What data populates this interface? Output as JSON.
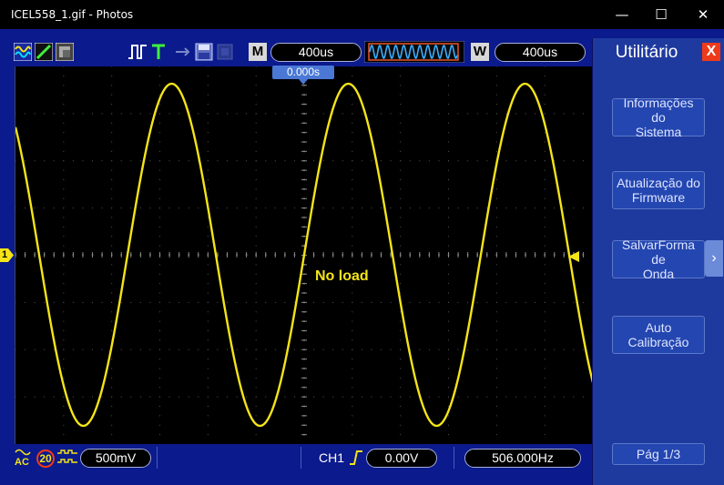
{
  "window": {
    "title": "ICEL558_1.gif - Photos",
    "minimize_glyph": "—",
    "maximize_glyph": "☐",
    "close_glyph": "✕"
  },
  "toolbar": {
    "mode_badge": "M",
    "timebase": "400us",
    "window_badge": "W",
    "window_timebase": "400us",
    "trigger_position": "0.000s"
  },
  "screen": {
    "annotation": "No load",
    "channel_marker": "1"
  },
  "status": {
    "coupling": "AC",
    "bw_limit": "20",
    "volts_div": "500mV",
    "trigger_source": "CH1",
    "trigger_level": "0.00V",
    "frequency": "506.000Hz"
  },
  "menu": {
    "title": "Utilitário",
    "close_glyph": "X",
    "items": [
      {
        "line1": "Informações do",
        "line2": "Sistema"
      },
      {
        "line1": "Atualização do",
        "line2": "Firmware"
      },
      {
        "line1": "SalvarForma de",
        "line2": "Onda"
      },
      {
        "line1": "Auto",
        "line2": "Calibração"
      }
    ],
    "page": "Pág  1/3",
    "next_glyph": "›"
  },
  "colors": {
    "trace": "#f4e418",
    "frame": "#0b1a8c",
    "menu_bg": "#1e3a9e",
    "close_red": "#ef3a1a"
  }
}
